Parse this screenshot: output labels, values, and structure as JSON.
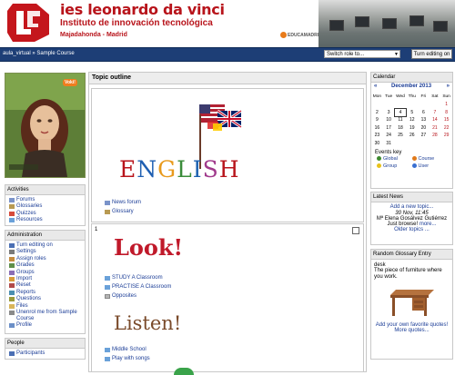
{
  "header": {
    "school_name": "ies leonardo da vinci",
    "subtitle": "Instituto de innovación tecnológica",
    "city": "Majadahonda - Madrid",
    "partner": "EDUCAMADRID"
  },
  "navbar": {
    "breadcrumb": "aula_virtual » Sample Course",
    "switch_role": "Switch role to...",
    "turn_editing_button": "Turn editing on"
  },
  "left": {
    "activities": {
      "title": "Activities",
      "items": [
        "Forums",
        "Glossaries",
        "Quizzes",
        "Resources"
      ]
    },
    "administration": {
      "title": "Administration",
      "items": [
        "Turn editing on",
        "Settings",
        "Assign roles",
        "Grades",
        "Groups",
        "Import",
        "Reset",
        "Reports",
        "Questions",
        "Files",
        "Unenrol me from Sample Course",
        "Profile"
      ]
    },
    "people": {
      "title": "People",
      "items": [
        "Participants"
      ]
    },
    "avatar_badge": "Voki!"
  },
  "main": {
    "title": "Topic outline",
    "section0_links": [
      "News forum",
      "Glossary"
    ],
    "english_word": "ENGLISH",
    "section1_number": "1",
    "look_word": "Look!",
    "section1_links": [
      "STUDY A Classroom",
      "PRACTISE A Classroom",
      "Opposites"
    ],
    "listen_word": "Listen!",
    "section1_links2": [
      "Middle School",
      "Play with songs"
    ]
  },
  "calendar": {
    "title": "Calendar",
    "prev": "«",
    "next": "»",
    "month": "December 2013",
    "weekdays": [
      "Mon",
      "Tue",
      "Wed",
      "Thu",
      "Fri",
      "Sat",
      "Sun"
    ],
    "weeks": [
      [
        "",
        "",
        "",
        "",
        "",
        "",
        "1"
      ],
      [
        "2",
        "3",
        "4",
        "5",
        "6",
        "7",
        "8"
      ],
      [
        "9",
        "10",
        "11",
        "12",
        "13",
        "14",
        "15"
      ],
      [
        "16",
        "17",
        "18",
        "19",
        "20",
        "21",
        "22"
      ],
      [
        "23",
        "24",
        "25",
        "26",
        "27",
        "28",
        "29"
      ],
      [
        "30",
        "31",
        "",
        "",
        "",
        "",
        ""
      ]
    ],
    "today": "4",
    "events_key_label": "Events key",
    "keys": [
      {
        "label": "Global",
        "color": "#3d8a2f"
      },
      {
        "label": "Course",
        "color": "#e07a1b"
      },
      {
        "label": "Group",
        "color": "#e8c21a"
      },
      {
        "label": "User",
        "color": "#3a6fd1"
      }
    ]
  },
  "latest_news": {
    "title": "Latest News",
    "add_topic": "Add a new topic...",
    "date": "30 Nov, 11:45",
    "author": "Mª Elena Gosálvez Gutiérrez",
    "snippet": "Just browse!",
    "more": "more...",
    "older": "Older topics ..."
  },
  "glossary": {
    "title": "Random Glossary Entry",
    "term": "desk",
    "definition": "The piece of furniture where you work.",
    "add_link": "Add your own favorite quotes!",
    "more_link": "More quotes..."
  }
}
